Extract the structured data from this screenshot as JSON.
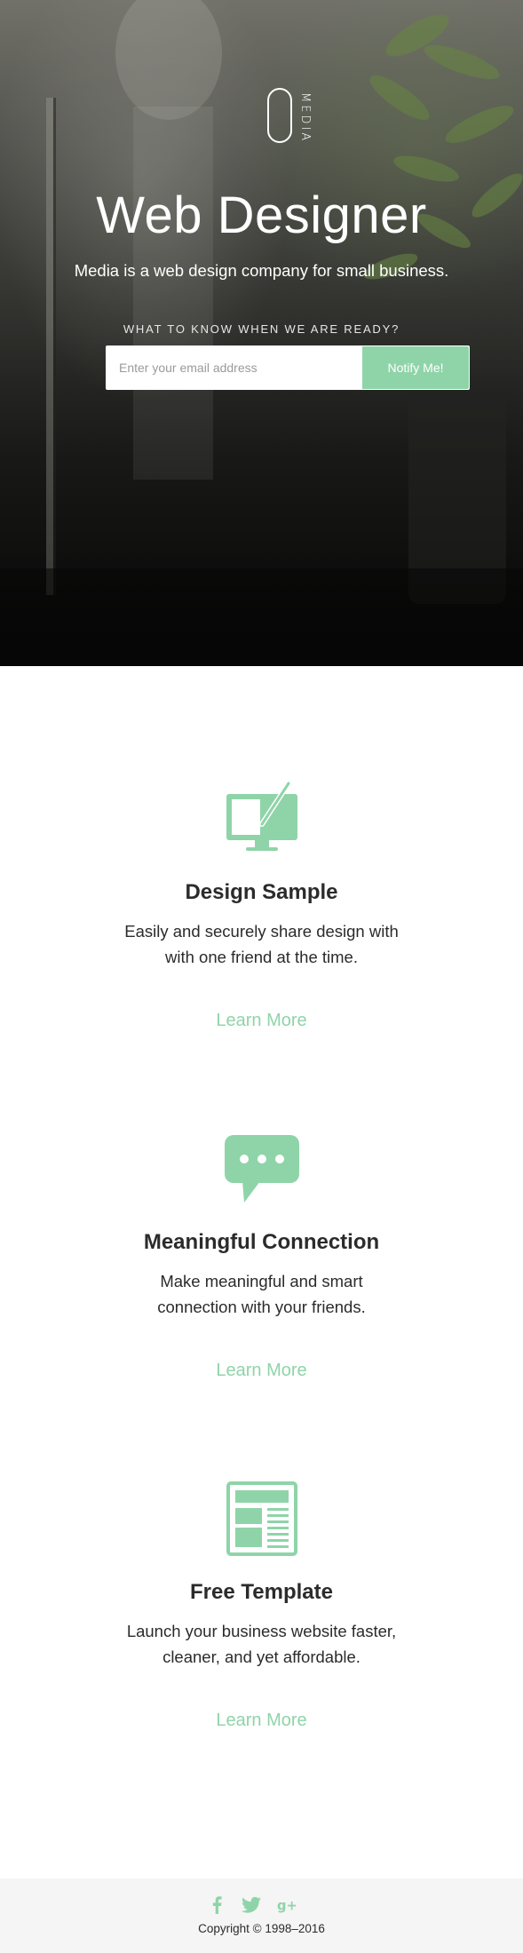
{
  "hero": {
    "logo_text": "MEDIA",
    "title": "Web Designer",
    "subtitle": "Media is a web design company for small business.",
    "prompt": "WHAT TO KNOW WHEN WE ARE READY?",
    "email_placeholder": "Enter your email address",
    "email_value": "",
    "notify_label": "Notify Me!"
  },
  "features": [
    {
      "icon": "monitor-pen-icon",
      "title": "Design Sample",
      "desc": "Easily and securely share design with with one friend at the time.",
      "link": "Learn More"
    },
    {
      "icon": "chat-bubble-icon",
      "title": "Meaningful Connection",
      "desc": "Make meaningful and smart connection with your friends.",
      "link": "Learn More"
    },
    {
      "icon": "newspaper-template-icon",
      "title": "Free Template",
      "desc": "Launch your business website faster, cleaner, and yet affordable.",
      "link": "Learn More"
    }
  ],
  "footer": {
    "social": [
      "facebook-icon",
      "twitter-icon",
      "google-plus-icon"
    ],
    "copyright": "Copyright © 1998–2016"
  },
  "colors": {
    "accent": "#8fd4a8",
    "text": "#2b2b2b",
    "footer_bg": "#f5f5f5"
  }
}
